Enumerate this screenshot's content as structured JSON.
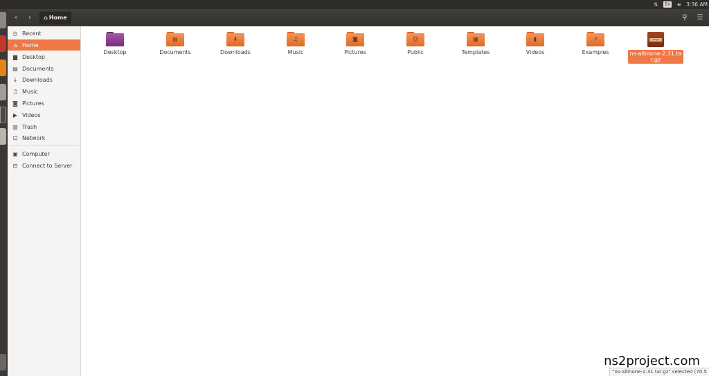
{
  "top_panel": {
    "icons": [
      "network-icon",
      "keyboard-icon",
      "volume-icon"
    ],
    "keyboard": "En",
    "clock": "3:36 AM"
  },
  "header": {
    "back_icon": "chevron-left-icon",
    "forward_icon": "chevron-right-icon",
    "breadcrumb": "Home",
    "right_icons": [
      "search-icon",
      "list-view-icon"
    ]
  },
  "sidebar": {
    "items": [
      {
        "label": "Recent",
        "icon": "clock-icon"
      },
      {
        "label": "Home",
        "icon": "home-icon",
        "active": true
      },
      {
        "label": "Desktop",
        "icon": "folder-icon"
      },
      {
        "label": "Documents",
        "icon": "document-icon"
      },
      {
        "label": "Downloads",
        "icon": "download-icon"
      },
      {
        "label": "Music",
        "icon": "music-icon"
      },
      {
        "label": "Pictures",
        "icon": "camera-icon"
      },
      {
        "label": "Videos",
        "icon": "video-icon"
      },
      {
        "label": "Trash",
        "icon": "trash-icon"
      },
      {
        "label": "Network",
        "icon": "network-icon"
      },
      {
        "label": "Computer",
        "icon": "computer-icon"
      },
      {
        "label": "Connect to Server",
        "icon": "server-icon"
      }
    ]
  },
  "files": [
    {
      "name": "Desktop",
      "type": "folder-purple"
    },
    {
      "name": "Documents",
      "type": "folder"
    },
    {
      "name": "Downloads",
      "type": "folder"
    },
    {
      "name": "Music",
      "type": "folder"
    },
    {
      "name": "Pictures",
      "type": "folder"
    },
    {
      "name": "Public",
      "type": "folder"
    },
    {
      "name": "Templates",
      "type": "folder"
    },
    {
      "name": "Videos",
      "type": "folder"
    },
    {
      "name": "Examples",
      "type": "folder"
    },
    {
      "name": "ns-allinone-2.31.tar.gz",
      "type": "archive",
      "selected": true
    }
  ],
  "status_bar": "\"ns-allinone-2.31.tar.gz\" selected (70.5",
  "watermark": "ns2project.com",
  "colors": {
    "accent": "#f07746",
    "panel": "#2d2c28",
    "header": "#3a3935",
    "sidebar": "#f5f4f2",
    "launcher": "#3b3835"
  }
}
